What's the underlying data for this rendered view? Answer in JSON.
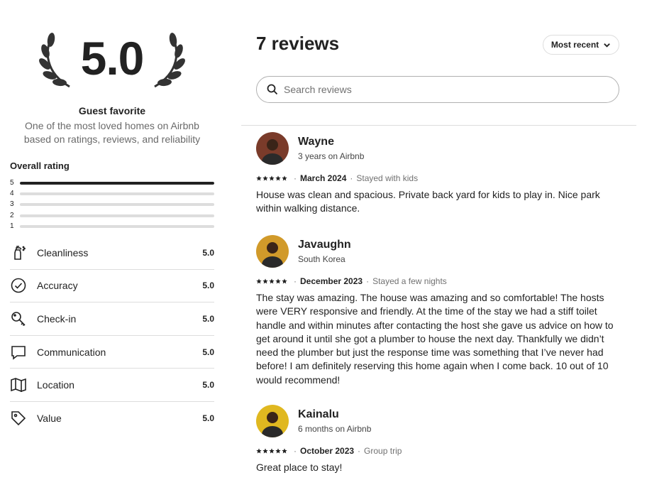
{
  "summary": {
    "score": "5.0",
    "badge_title": "Guest favorite",
    "badge_desc": "One of the most loved homes on Airbnb based on ratings, reviews, and reliability",
    "overall_label": "Overall rating",
    "distribution": [
      {
        "stars": "5",
        "fraction": 1.0
      },
      {
        "stars": "4",
        "fraction": 0.0
      },
      {
        "stars": "3",
        "fraction": 0.0
      },
      {
        "stars": "2",
        "fraction": 0.0
      },
      {
        "stars": "1",
        "fraction": 0.0
      }
    ],
    "categories": [
      {
        "label": "Cleanliness",
        "score": "5.0",
        "icon": "spray-bottle-icon"
      },
      {
        "label": "Accuracy",
        "score": "5.0",
        "icon": "check-circle-icon"
      },
      {
        "label": "Check-in",
        "score": "5.0",
        "icon": "key-icon"
      },
      {
        "label": "Communication",
        "score": "5.0",
        "icon": "chat-bubble-icon"
      },
      {
        "label": "Location",
        "score": "5.0",
        "icon": "map-icon"
      },
      {
        "label": "Value",
        "score": "5.0",
        "icon": "tag-icon"
      }
    ]
  },
  "reviews_panel": {
    "title": "7 reviews",
    "sort_label": "Most recent",
    "search_placeholder": "Search reviews",
    "reviews": [
      {
        "name": "Wayne",
        "subtitle": "3 years on Airbnb",
        "rating": 5,
        "date": "March 2024",
        "stay": "Stayed with kids",
        "text": "House was clean and spacious. Private back yard for kids to play in. Nice park within walking distance.",
        "avatar_color": "#7a3b2a"
      },
      {
        "name": "Javaughn",
        "subtitle": "South Korea",
        "rating": 5,
        "date": "December 2023",
        "stay": "Stayed a few nights",
        "text": "The stay was amazing. The house was amazing and so comfortable! The hosts were VERY responsive and friendly. At the time of the stay we had a stiff toilet handle and within minutes after contacting the host she gave us advice on how to get around it until she got a plumber to house the next day. Thankfully we didn’t need the plumber but just the response time was something that I’ve never had before! I am definitely reserving this home again when I come back. 10 out of 10 would recommend!",
        "avatar_color": "#d19a2a"
      },
      {
        "name": "Kainalu",
        "subtitle": "6 months on Airbnb",
        "rating": 5,
        "date": "October 2023",
        "stay": "Group trip",
        "text": "Great place to stay!",
        "avatar_color": "#e0b820"
      }
    ]
  }
}
